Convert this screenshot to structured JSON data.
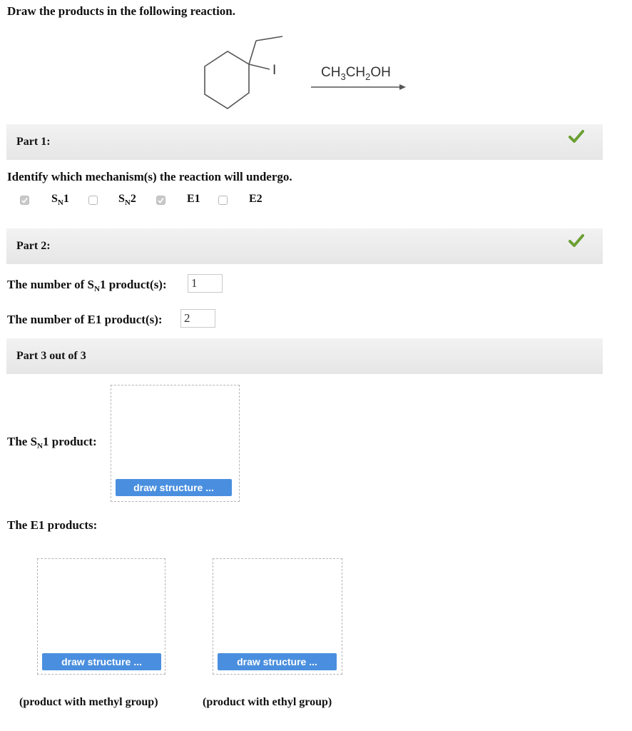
{
  "title": "Draw the products in the following reaction.",
  "reaction": {
    "leaving_group": "I",
    "reagent": {
      "p1": "CH",
      "s1": "3",
      "p2": "CH",
      "s2": "2",
      "p3": "OH"
    }
  },
  "part1": {
    "label": "Part 1:",
    "question": "Identify which mechanism(s) the reaction will undergo.",
    "options": [
      {
        "main": "S",
        "sub": "N",
        "tail": "1",
        "checked": true
      },
      {
        "main": "S",
        "sub": "N",
        "tail": "2",
        "checked": false
      },
      {
        "main": "E1",
        "sub": "",
        "tail": "",
        "checked": true
      },
      {
        "main": "E2",
        "sub": "",
        "tail": "",
        "checked": false
      }
    ]
  },
  "part2": {
    "label": "Part 2:",
    "sn1_prefix": "The number of S",
    "sn1_sub": "N",
    "sn1_suffix": "1 product(s):",
    "sn1_value": "1",
    "e1_label": "The number of E1 product(s):",
    "e1_value": "2"
  },
  "part3": {
    "label": "Part 3 out of 3",
    "sn1_prefix": "The S",
    "sn1_sub": "N",
    "sn1_suffix": "1 product:",
    "e1_label": "The E1 products:",
    "draw_label": "draw structure ...",
    "caption_methyl": "(product with methyl group)",
    "caption_ethyl": "(product with ethyl group)"
  },
  "colors": {
    "check": "#6aa033",
    "button": "#4a8fdf"
  }
}
